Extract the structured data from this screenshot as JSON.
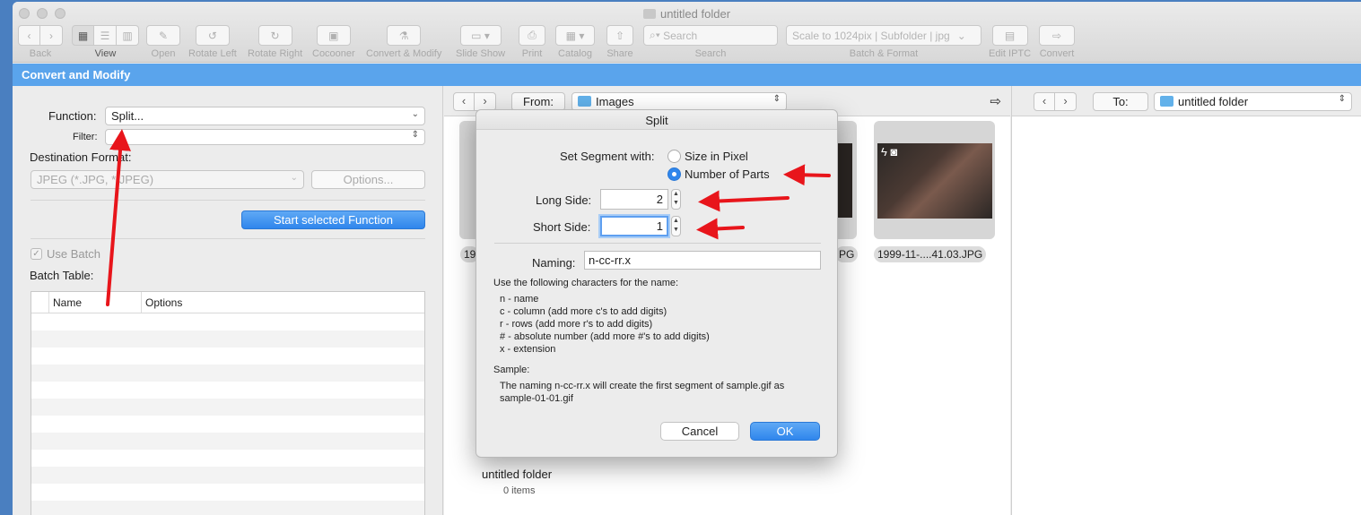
{
  "window": {
    "title": "untitled folder"
  },
  "toolbar": {
    "back": "Back",
    "view": "View",
    "open": "Open",
    "rotate_left": "Rotate Left",
    "rotate_right": "Rotate Right",
    "cocooner": "Cocooner",
    "convert_modify": "Convert & Modify",
    "slide_show": "Slide Show",
    "print": "Print",
    "catalog": "Catalog",
    "share": "Share",
    "search_placeholder": "Search",
    "search_label": "Search",
    "batch_value": "Scale to 1024pix | Subfolder | jpg",
    "batch_label": "Batch & Format",
    "edit_iptc": "Edit IPTC",
    "convert": "Convert"
  },
  "panel": {
    "header": "Convert and Modify",
    "function_label": "Function:",
    "function_value": "Split...",
    "filter_label": "Filter:",
    "filter_value": "",
    "dest_format_label": "Destination Format:",
    "dest_format_value": "JPEG (*.JPG, *.JPEG)",
    "options_button": "Options...",
    "start_button": "Start selected Function",
    "use_batch": "Use Batch",
    "batch_table_label": "Batch Table:",
    "columns": [
      "Name",
      "Options"
    ]
  },
  "browser": {
    "from_label": "From:",
    "from_path": "Images",
    "thumb_partial_left": "19",
    "thumb_partial_right": "PG",
    "thumb_visible": "1999-11-....41.03.JPG",
    "folder_name": "untitled folder",
    "folder_count": "0 items"
  },
  "destination": {
    "to_label": "To:",
    "to_path": "untitled folder"
  },
  "dialog": {
    "title": "Split",
    "segment_label": "Set Segment with:",
    "option_pixel": "Size in Pixel",
    "option_parts": "Number of Parts",
    "long_side_label": "Long Side:",
    "long_side_value": "2",
    "short_side_label": "Short Side:",
    "short_side_value": "1",
    "naming_label": "Naming:",
    "naming_value": "n-cc-rr.x",
    "help_intro": "Use the following characters for the name:",
    "help_lines": [
      "n - name",
      "c - column (add more c's to add digits)",
      "r - rows (add more r's to add digits)",
      "# - absolute number (add more #'s to add digits)",
      "x - extension"
    ],
    "sample_label": "Sample:",
    "sample_line1": "The naming n-cc-rr.x will create the first segment of sample.gif as",
    "sample_line2": "sample-01-01.gif",
    "cancel": "Cancel",
    "ok": "OK"
  },
  "colors": {
    "accent": "#2f86ec",
    "header": "#5aa4ec",
    "annotation": "#e8151b"
  }
}
